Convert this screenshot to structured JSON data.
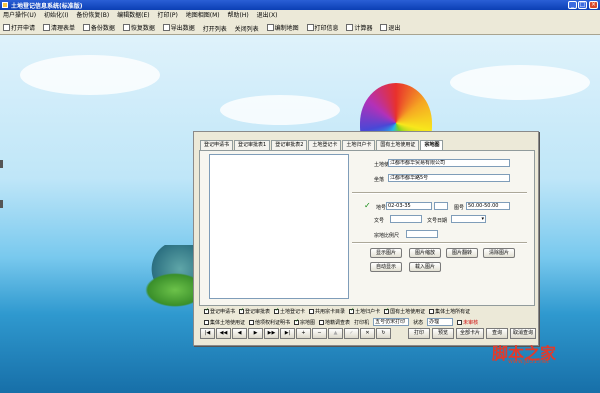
{
  "window": {
    "title": "土地登记信息系统(标准版)",
    "controls": [
      "_",
      "□",
      "×"
    ]
  },
  "menu": [
    "用户操作(U)",
    "初始化(I)",
    "备份恢复(B)",
    "编辑数据(E)",
    "打印(P)",
    "地图相图(M)",
    "帮助(H)",
    "退出(X)"
  ],
  "toolbar": [
    {
      "label": "打开申请",
      "icon": "folder-open-icon"
    },
    {
      "label": "清理表单",
      "icon": "clear-icon"
    },
    {
      "label": "备份数据",
      "icon": "backup-icon"
    },
    {
      "label": "恢复数据",
      "icon": "restore-icon"
    },
    {
      "label": "导出数据",
      "icon": "export-icon"
    },
    {
      "label": "打开列表",
      "icon": "list-icon"
    },
    {
      "label": "关闭列表",
      "icon": "close-list-icon"
    },
    {
      "label": "编制地图",
      "icon": "map-icon"
    },
    {
      "label": "打印信息",
      "icon": "print-icon"
    },
    {
      "label": "计算器",
      "icon": "calculator-icon"
    },
    {
      "label": "退出",
      "icon": "exit-icon"
    }
  ],
  "dialog": {
    "tabs": [
      "登记申请书",
      "登记审批表1",
      "登记审批表2",
      "土地登记卡",
      "土地归户卡",
      "国有土地使用证",
      "宗地图"
    ],
    "active_tab": "宗地图",
    "fields": {
      "owner_label": "土地使用者",
      "owner_value": "江都市都华贸易有限公司",
      "location_label": "坐落",
      "location_value": "江都市都华路5号",
      "parcel_label": "地号",
      "parcel_value": "02-03-35",
      "map_no_label": "图号",
      "map_no_value": "50.00-50.00",
      "doc_no_label": "文号",
      "doc_date_label": "文号日期",
      "scale_label": "宗地比例尺"
    },
    "image_buttons": [
      "显示图片",
      "图片缩放",
      "图片翻转",
      "清除图片",
      "自动显示",
      "载入图片"
    ],
    "checkbox_rows": [
      [
        {
          "label": "登记申请书",
          "checked": true
        },
        {
          "label": "登记审批表",
          "checked": true
        },
        {
          "label": "土地登记卡",
          "checked": true
        },
        {
          "label": "共用宗卡目录",
          "checked": false
        },
        {
          "label": "土地归户卡",
          "checked": true
        },
        {
          "label": "国有土地使用证",
          "checked": true
        },
        {
          "label": "集体土地所有证",
          "checked": false
        }
      ],
      [
        {
          "label": "集体土地使用证",
          "checked": false
        },
        {
          "label": "他项权利证明书",
          "checked": false
        },
        {
          "label": "宗地图",
          "checked": true
        },
        {
          "label": "地籍调查表",
          "checked": false
        }
      ]
    ],
    "print_row": {
      "printer_label": "打印机",
      "printer_value": "五号仿宋打印",
      "status_label": "状态",
      "status_value": "办理",
      "flag_label": "未审核"
    },
    "nav_buttons": [
      "|◀",
      "◀◀",
      "◀",
      "▶",
      "▶▶",
      "▶|",
      "+",
      "−",
      "▲",
      "✓",
      "✕",
      "↻"
    ],
    "action_buttons": [
      "打印",
      "预览",
      "全部卡片",
      "查询",
      "取消查询"
    ]
  },
  "watermark": {
    "text": "脚本之家",
    "url": "www.jb51.net"
  }
}
